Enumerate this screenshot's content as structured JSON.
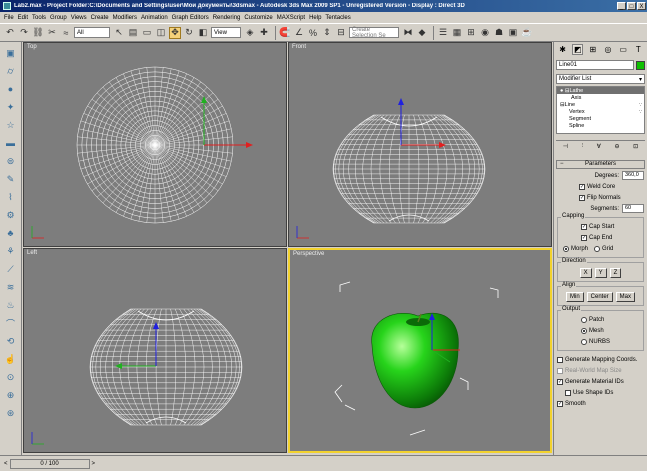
{
  "window": {
    "title": "Lab2.max - Project Folder:C:\\Documents and Settings\\user\\Мои документы\\3dsmax - Autodesk 3ds Max 2009 SP1 - Unregistered Version - Display : Direct 3D",
    "buttons": [
      "_",
      "□",
      "X"
    ]
  },
  "menu": [
    "File",
    "Edit",
    "Tools",
    "Group",
    "Views",
    "Create",
    "Modifiers",
    "Animation",
    "Graph Editors",
    "Rendering",
    "Customize",
    "MAXScript",
    "Help",
    "Tentacles"
  ],
  "toolbar": {
    "selection_filter": "All",
    "reference_coord": "View",
    "named_selection_placeholder": "Create Selection Se"
  },
  "viewports": {
    "top": "Top",
    "front": "Front",
    "left": "Left",
    "perspective": "Perspective"
  },
  "command_panel": {
    "object_name": "Line01",
    "object_color": "#0fc000",
    "modifier_list": "Modifier List",
    "stack": [
      {
        "label": "Lathe",
        "selected": true
      },
      {
        "label": "Axis",
        "selected": false
      },
      {
        "label": "Line",
        "selected": false
      },
      {
        "label": "Vertex",
        "selected": false
      },
      {
        "label": "Segment",
        "selected": false
      },
      {
        "label": "Spline",
        "selected": false
      }
    ],
    "parameters": {
      "title": "Parameters",
      "degrees_label": "Degrees:",
      "degrees_value": "360,0",
      "weld_core": "Weld Core",
      "flip_normals": "Flip Normals",
      "segments_label": "Segments:",
      "segments_value": "60",
      "capping_title": "Capping",
      "cap_start": "Cap Start",
      "cap_end": "Cap End",
      "morph": "Morph",
      "grid": "Grid",
      "direction_title": "Direction",
      "dir_x": "X",
      "dir_y": "Y",
      "dir_z": "Z",
      "align_title": "Align",
      "align_min": "Min",
      "align_center": "Center",
      "align_max": "Max",
      "output_title": "Output",
      "patch": "Patch",
      "mesh": "Mesh",
      "nurbs": "NURBS",
      "gen_mapping": "Generate Mapping Coords.",
      "real_world": "Real-World Map Size",
      "gen_material": "Generate Material IDs",
      "use_shape": "Use Shape IDs",
      "smooth": "Smooth"
    }
  },
  "timeline": {
    "frame": "0 / 100"
  }
}
